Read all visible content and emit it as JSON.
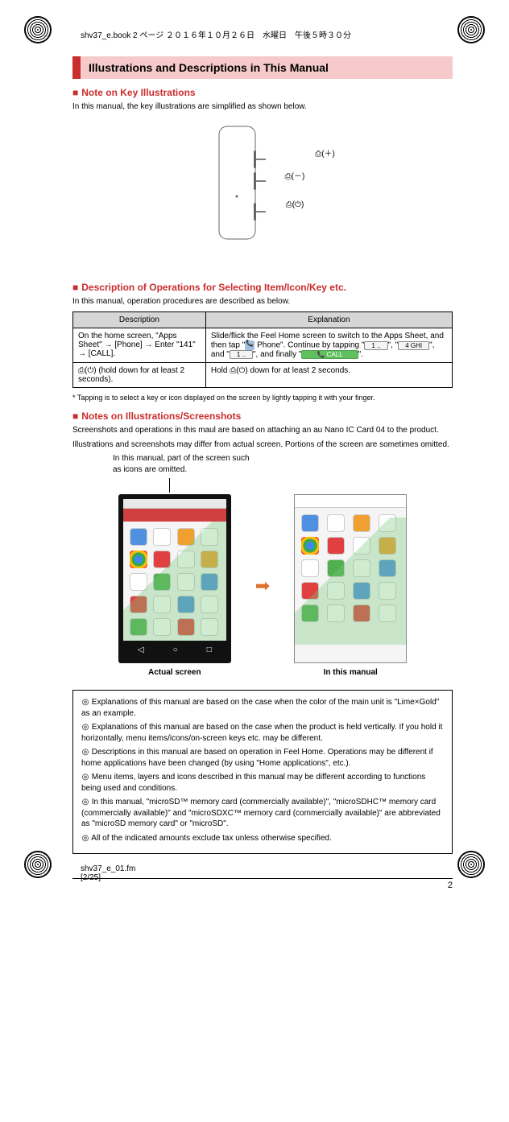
{
  "meta": {
    "bookinfo": "shv37_e.book  2 ページ  ２０１６年１０月２６日　水曜日　午後５時３０分",
    "footer_file": "shv37_e_01.fm",
    "footer_pos": "[2/25]",
    "page_number": "2"
  },
  "section": {
    "title": "Illustrations and Descriptions in This Manual"
  },
  "sub1": {
    "heading": "Note on Key Illustrations",
    "body": "In this manual, the key illustrations are simplified as shown below.",
    "key_plus": "(＋)",
    "key_minus": "(－)",
    "key_power": "(⏻)"
  },
  "sub2": {
    "heading": "Description of Operations for Selecting Item/Icon/Key etc.",
    "body": "In this manual, operation procedures are described as below.",
    "th_desc": "Description",
    "th_expl": "Explanation",
    "row1_desc": "On the home screen, \"Apps Sheet\" → [Phone] → Enter \"141\" → [CALL].",
    "row1_expl_a": "Slide/flick the Feel Home screen to switch to the Apps Sheet, and then tap \"",
    "row1_expl_b": " Phone\". Continue by tapping \"",
    "row1_expl_c": "\", \"",
    "row1_expl_d": "\", and \"",
    "row1_expl_e": "\", and finally \"",
    "row1_expl_f": "\".",
    "key1": "1 ..",
    "key4": "4 GHI",
    "key1b": "1 ..",
    "keycall": "📞 CALL",
    "row2_desc": "⎙(⏻) (hold down for at least 2 seconds).",
    "row2_expl": "Hold ⎙(⏻) down for at least 2 seconds.",
    "footnote": "*  Tapping is to select a key or icon displayed on the screen by lightly tapping it with your finger."
  },
  "sub3": {
    "heading": "Notes on Illustrations/Screenshots",
    "body1": "Screenshots and operations in this maul are based on attaching an au Nano IC Card 04 to the product.",
    "body2": "Illustrations and screenshots may differ from actual screen. Portions of the screen are sometimes omitted.",
    "caption_note": "In this manual, part of the screen such as icons are omitted.",
    "left_caption": "Actual screen",
    "right_caption": "In this manual"
  },
  "notes": {
    "n1": "Explanations of this manual are based on the case when the color of the main unit is \"Lime×Gold\" as an example.",
    "n2": "Explanations of this manual are based on the case when the product is held vertically. If you hold it horizontally, menu items/icons/on-screen keys etc. may be different.",
    "n3": "Descriptions in this manual are based on operation in Feel Home. Operations may be different if home applications have been changed (by using \"Home applications\", etc.).",
    "n4": "Menu items, layers and icons described in this manual may be different according to functions being used and conditions.",
    "n5": "In this manual, \"microSD™ memory card (commercially available)\", \"microSDHC™ memory card (commercially available)\" and \"microSDXC™ memory card (commercially available)\" are abbreviated as \"microSD memory card\" or \"microSD\".",
    "n6": "All of the indicated amounts exclude tax unless otherwise specified."
  }
}
